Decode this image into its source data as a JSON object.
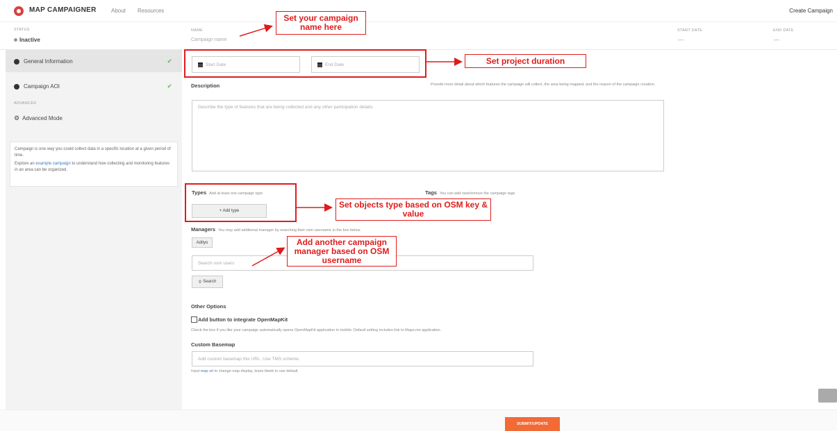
{
  "header": {
    "brand": "MAP CAMPAIGNER",
    "nav": [
      "About",
      "Resources"
    ],
    "create_label": "Create Campaign"
  },
  "status_bar": {
    "status_label": "STATUS",
    "status_value": "Inactive",
    "name_label": "NAME",
    "name_placeholder": "Campaign name",
    "start_date_label": "START DATE",
    "start_date_value": "—",
    "end_date_label": "END DATE",
    "end_date_value": "—"
  },
  "sidebar": {
    "items": [
      {
        "label": "General Information",
        "done": true
      },
      {
        "label": "Campaign AOI",
        "done": true
      }
    ],
    "advanced_label": "ADVANCED",
    "advanced_item": "Advanced Mode",
    "info_line1": "Campaign is one way you could collect data in a specific location at a given period of time.",
    "info_pre": "Explore an ",
    "info_link": "example campaign",
    "info_post": " to understand how collecting and monitoring features in an area can be organized."
  },
  "form": {
    "start_date_placeholder": "Start Date",
    "end_date_placeholder": "End Date",
    "description_title": "Description",
    "description_hint": "Provide more detail about which features the campaign will collect, the area being mapped, and the reason of the campaign creation.",
    "description_placeholder": "Describe the type of features that are being collected and any other participation details.",
    "types_title": "Types",
    "types_hint": "Add at least one campaign type",
    "add_type_label": "+ Add type",
    "tags_title": "Tags",
    "tags_hint": "You can add new/remove the campaign tags",
    "managers_title": "Managers",
    "managers_hint": "You may add additional manager by searching their osm username in the box below.",
    "manager_chip": "Adityo",
    "search_placeholder": "Search osm users",
    "search_label": "Search",
    "other_title": "Other Options",
    "omk_label": "Add button to integrate OpenMapKit",
    "omk_hint": "Check the box if you like your campaign automatically opens OpenMapKit application in mobile. Default setting includes link to Maps.me application.",
    "basemap_title": "Custom Basemap",
    "basemap_placeholder": "Add custom basemap this URL. Use TMS scheme.",
    "basemap_hint_pre": "Input ",
    "basemap_hint_link": "map url",
    "basemap_hint_post": " to change map display, leave blank to use default",
    "submit_label": "SUBMIT/UPDATE"
  },
  "annotations": {
    "name": "Set your campaign name here",
    "duration": "Set project duration",
    "types": "Set objects type based on OSM key & value",
    "manager": "Add another campaign manager based on OSM username"
  },
  "colors": {
    "accent": "#f26a36",
    "annotation": "#e01b1b",
    "brand": "#d9413f"
  }
}
